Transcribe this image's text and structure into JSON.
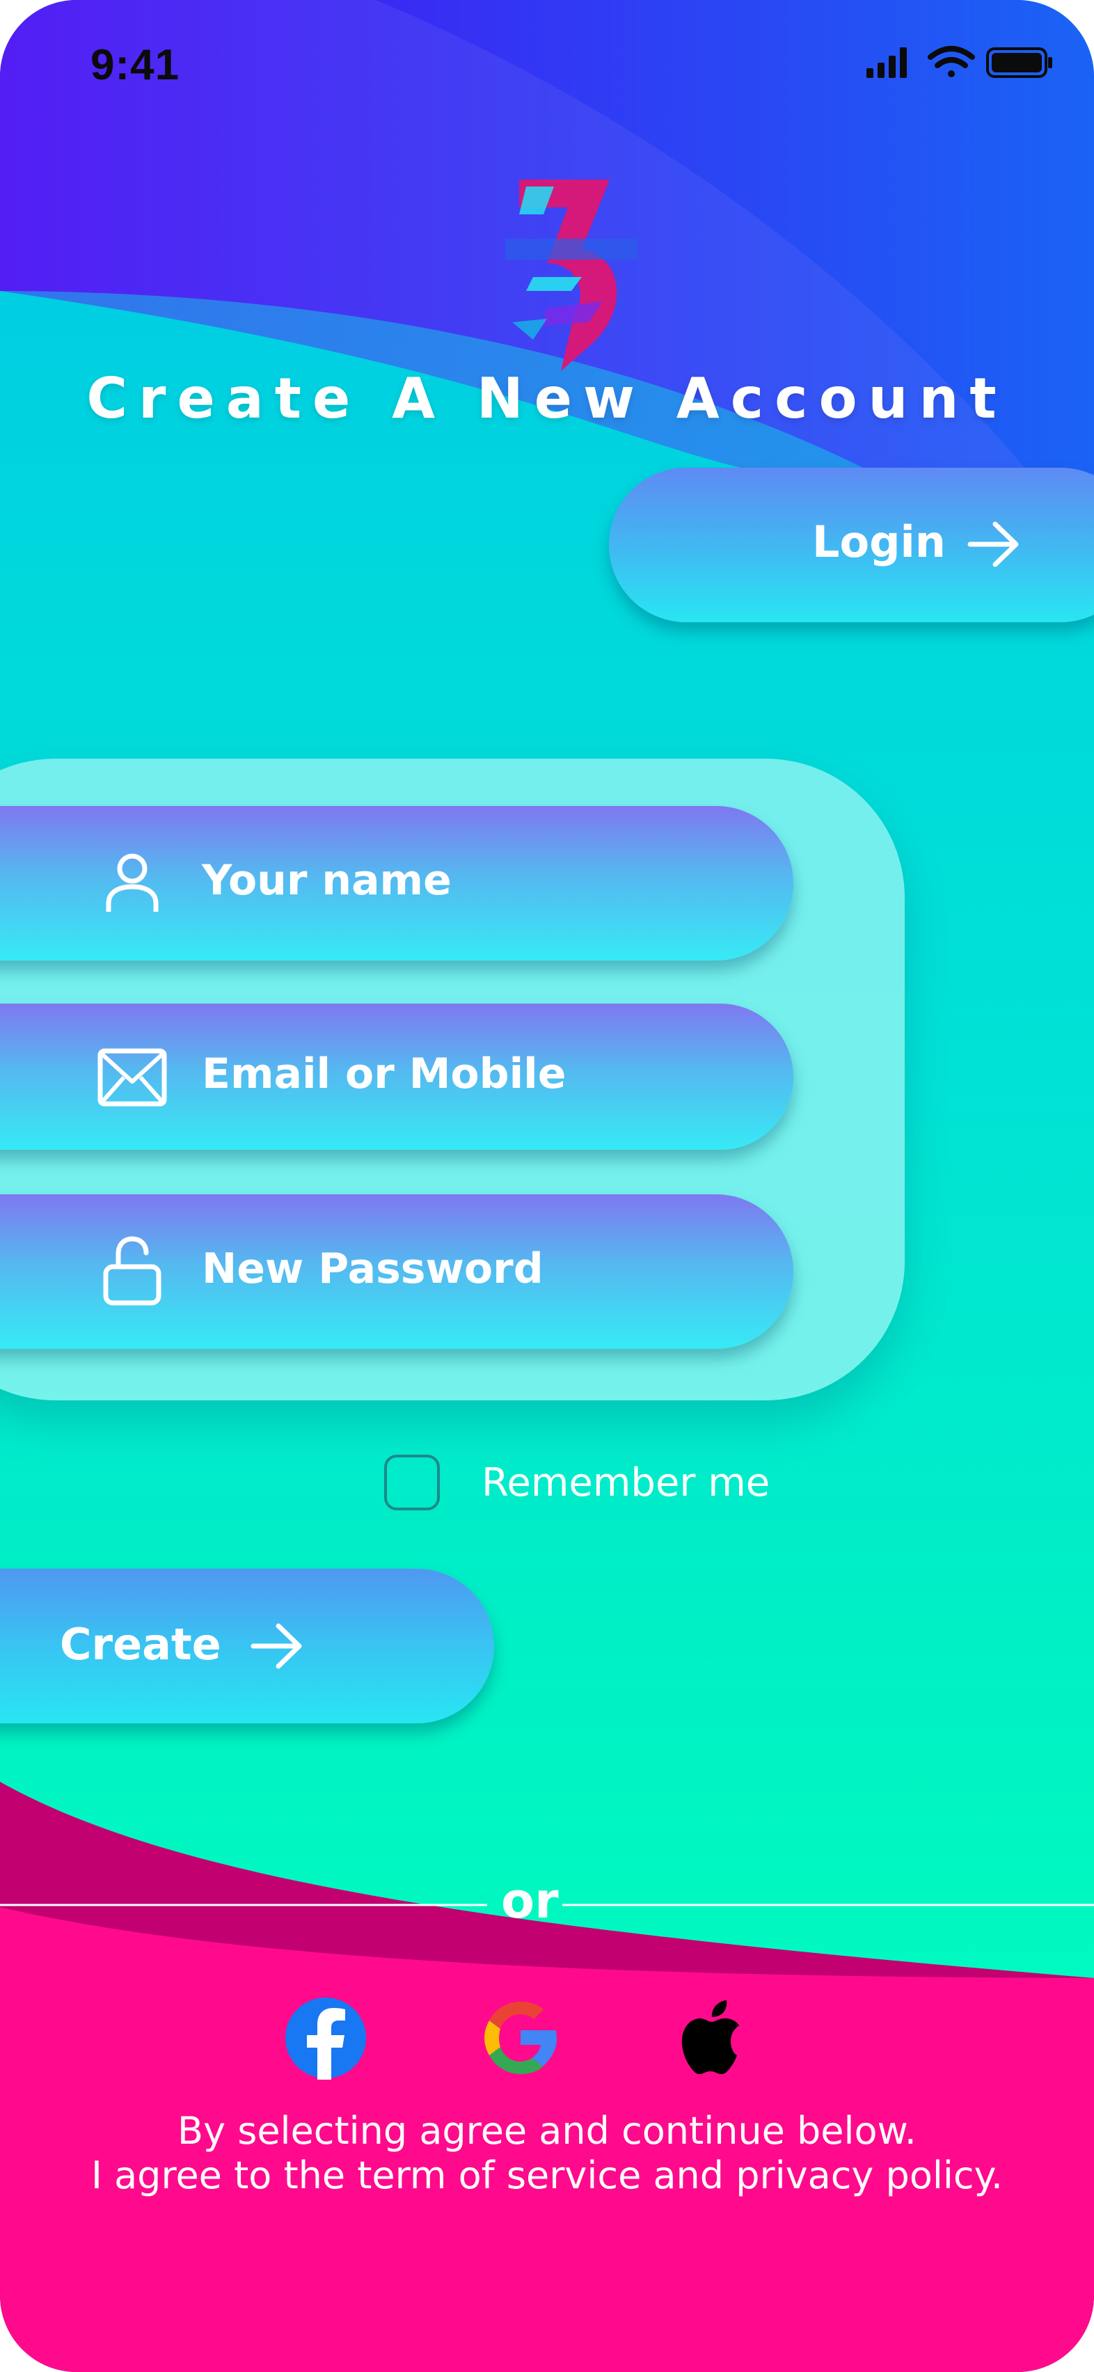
{
  "status_bar": {
    "time": "9:41"
  },
  "header": {
    "title": "Create A New Account"
  },
  "login_button": {
    "label": "Login"
  },
  "form": {
    "name_placeholder": "Your name",
    "email_placeholder": "Email or Mobile",
    "password_placeholder": "New Password"
  },
  "remember": {
    "label": "Remember me",
    "checked": false
  },
  "create_button": {
    "label": "Create"
  },
  "divider": {
    "label": "or"
  },
  "social": [
    "facebook-icon",
    "google-icon",
    "apple-icon"
  ],
  "legal": {
    "line1": "By selecting agree and continue below.",
    "line2": "I agree to the term of service and privacy policy."
  },
  "colors": {
    "top_violet": "#4a0cf2",
    "top_blue": "#1a63f5",
    "teal": "#00d8dc",
    "mint": "#00ffbe",
    "magenta": "#ff0a8c",
    "dark_magenta": "#c2006f",
    "text_white": "#ffffff"
  }
}
